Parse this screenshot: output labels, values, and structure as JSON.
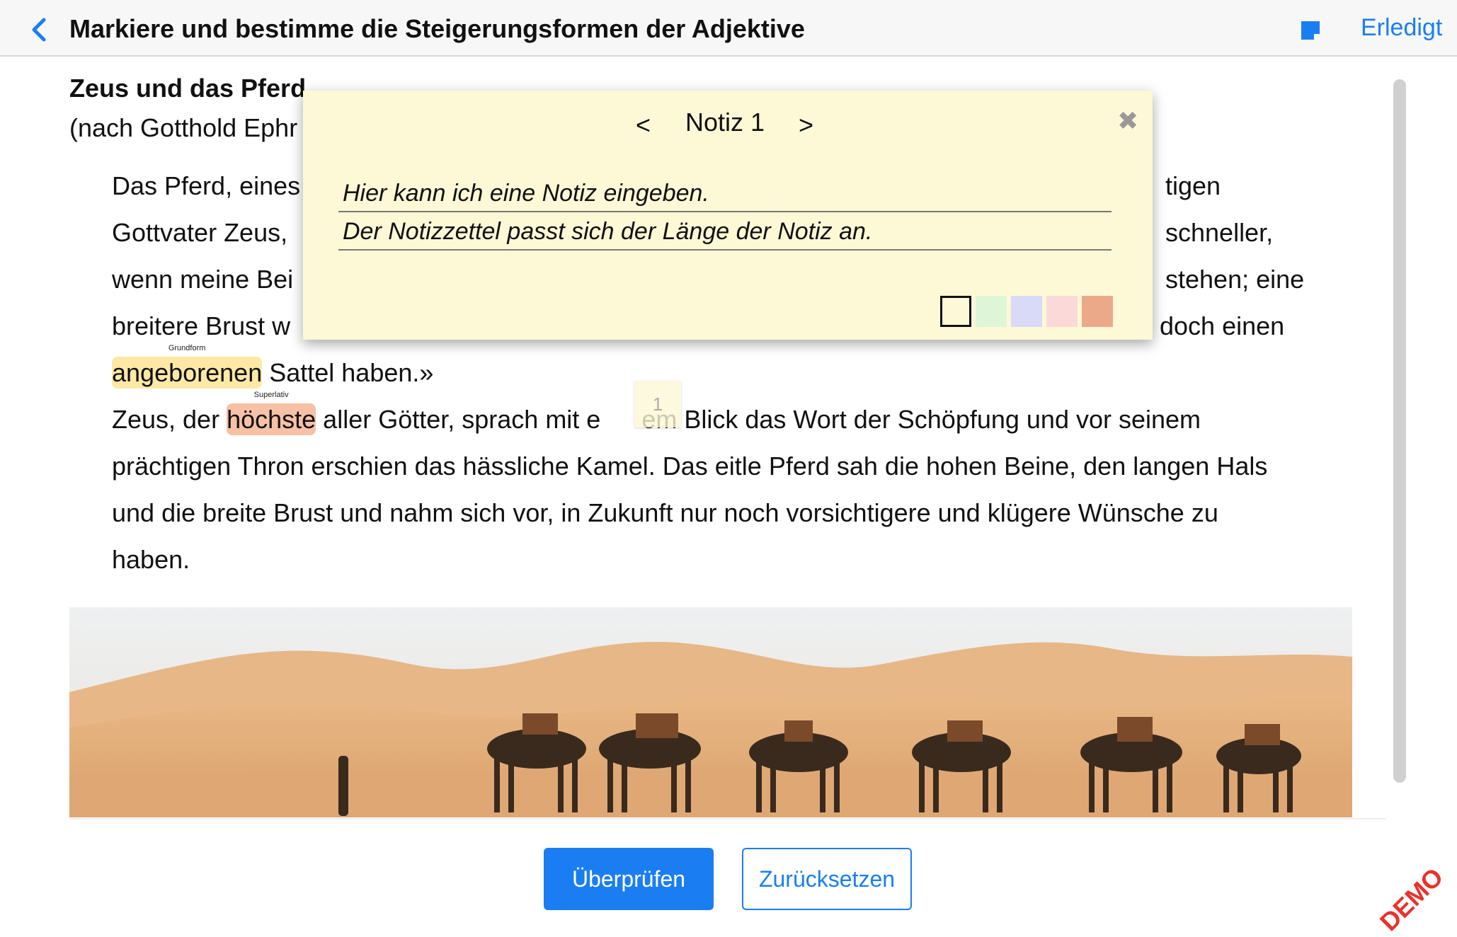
{
  "header": {
    "title": "Markiere und bestimme die Steigerungsformen der Adjektive",
    "done_label": "Erledigt",
    "back_icon": "chevron-left-icon",
    "note_icon": "sticky-note-icon"
  },
  "story": {
    "title": "Zeus und das Pferd",
    "subtitle": "(nach Gotthold Ephr",
    "lines": [
      "Das Pferd, eines",
      "Gottvater Zeus,",
      "wenn meine Bei",
      "breitere Brust w"
    ],
    "lines_right": [
      "tigen",
      "schneller,",
      "stehen; eine",
      "doch einen"
    ],
    "line5_highlight": "angeboren",
    "line5_highlight_tail": "en",
    "line5_highlight_label": "Grundform",
    "line5_rest": " Sattel haben.»",
    "line6_start": "Zeus, der ",
    "line6_highlight": "höchste",
    "line6_highlight_label": "Superlativ",
    "line6_rest": " aller Götter, sprach mit e",
    "line6_rest2": "em Blick das Wort der Schöpfung und vor seinem",
    "line7": "prächtigen Thron erschien das hässliche Kamel. Das eitle Pferd sah die hohen Beine, den langen Hals",
    "line8": "und die breite Brust und nahm sich vor, in Zukunft nur noch vorsichtigere und klügere Wünsche zu",
    "line9": "haben."
  },
  "note": {
    "prev": "<",
    "title": "Notiz 1",
    "next": ">",
    "close_icon": "close-icon",
    "text_lines": [
      "Hier kann ich eine Notiz eingeben.",
      "Der Notizzettel passt sich der Länge der Notiz an."
    ],
    "colors": [
      "#fdf8d6",
      "#dff5d8",
      "#d9d9f8",
      "#fbd9d9",
      "#eba98a"
    ],
    "marker_number": "1"
  },
  "buttons": {
    "check": "Überprüfen",
    "reset": "Zurücksetzen"
  },
  "watermark": "DEMO",
  "colors": {
    "accent": "#1a7ef2",
    "highlight_yellow": "#fde9a5",
    "highlight_orange": "#f6c1a4",
    "note_bg": "#fdf8d6",
    "demo": "#e8322c"
  }
}
